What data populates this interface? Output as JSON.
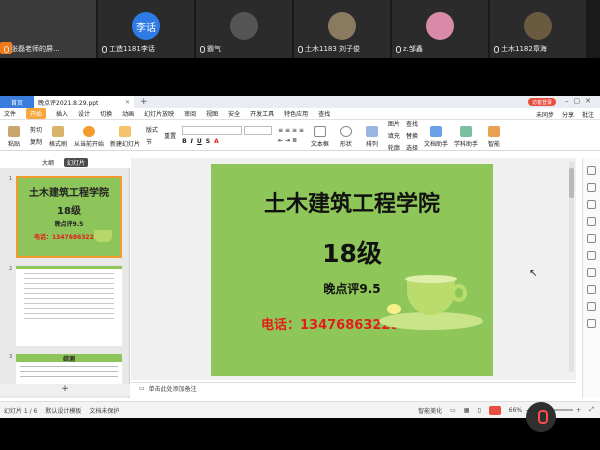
{
  "meeting": {
    "participants": [
      {
        "name": "张磊老师的屏...",
        "avatar_text": "",
        "avatar_color": "#3a3a3a"
      },
      {
        "name": "工造1181李话",
        "avatar_text": "李话",
        "avatar_color": "#2f7be5"
      },
      {
        "name": "霸气",
        "avatar_text": "",
        "avatar_color": "#555555"
      },
      {
        "name": "土木1183 刘子俊",
        "avatar_text": "",
        "avatar_color": "#8a7a60"
      },
      {
        "name": "z.邹鑫",
        "avatar_text": "",
        "avatar_color": "#d88aa8"
      },
      {
        "name": "土木1182章海",
        "avatar_text": "",
        "avatar_color": "#6a5a40"
      }
    ]
  },
  "tabs": {
    "home": "首页",
    "document": "晚点评2021.8.29.ppt",
    "login": "访客登录"
  },
  "menu": {
    "file": "文件",
    "items": [
      "开始",
      "插入",
      "设计",
      "切换",
      "动画",
      "幻灯片放映",
      "审阅",
      "视图",
      "安全",
      "开发工具",
      "特色应用"
    ],
    "search": "查找",
    "right": [
      "未同步",
      "分享",
      "批注"
    ]
  },
  "ribbon": {
    "paste": "粘贴",
    "cut": "剪切",
    "copy": "复制",
    "format_painter": "格式刷",
    "from_current": "从当前开始",
    "new_slide": "新建幻灯片",
    "layout": "版式",
    "reset": "重置",
    "section": "节",
    "textbox": "文本框",
    "shape": "形状",
    "arrange": "排列",
    "picture": "图片",
    "fill": "填充",
    "outline": "轮廓",
    "find": "查找",
    "replace": "替换",
    "select": "选择",
    "text_tools": "文档助手",
    "academic": "学科助手",
    "more": "智能"
  },
  "panel": {
    "outline_tab": "大纲",
    "slides_tab": "幻灯片"
  },
  "thumbs": {
    "s1_title": "土木建筑工程学院",
    "s1_grade": "18级",
    "s1_sub": "晚点评9.5",
    "s1_phone": "电话：13476863229",
    "s3_title": "综测",
    "nums": [
      "1",
      "2",
      "3"
    ]
  },
  "slide": {
    "title": "土木建筑工程学院",
    "grade": "18级",
    "subtitle": "晚点评9.5",
    "phone": "电话：13476863229"
  },
  "notes": {
    "placeholder": "单击此处添加备注"
  },
  "status": {
    "slide_counter": "幻灯片 1 / 6",
    "design": "默认设计模板",
    "protect": "文档未保护",
    "beautify": "智能美化",
    "zoom": "66%"
  },
  "colors": {
    "slide_green": "#8fc65a",
    "accent_orange": "#f6a63a",
    "phone_red": "#e51c1c",
    "home_tab_blue": "#3b7ddd"
  }
}
